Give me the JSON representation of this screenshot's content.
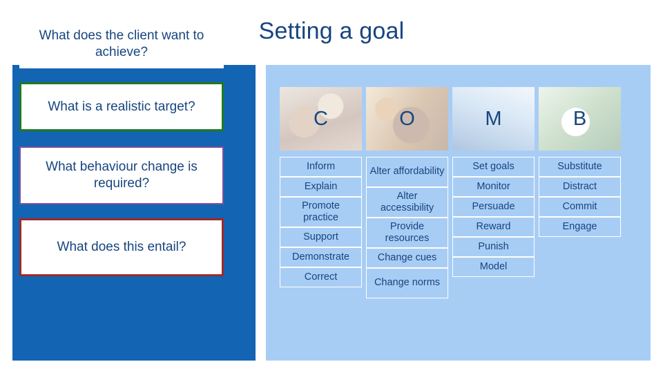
{
  "slide": {
    "title": "Setting a goal"
  },
  "left_panel": {
    "questions": [
      {
        "text": "What does the client want to achieve?",
        "border_color": "#ffffff"
      },
      {
        "text": "What is a realistic target?",
        "border_color": "#1f7a1f"
      },
      {
        "text": "What behaviour change is required?",
        "border_color": "#7e4f9e"
      },
      {
        "text": "What does this entail?",
        "border_color": "#9e2a2a"
      }
    ]
  },
  "com_b": {
    "columns": [
      {
        "letter": "C",
        "image_name": "capability-photo",
        "items": [
          {
            "label": "Inform",
            "size": "one"
          },
          {
            "label": "Explain",
            "size": "one"
          },
          {
            "label": "Promote practice",
            "size": "two"
          },
          {
            "label": "Support",
            "size": "one"
          },
          {
            "label": "Demonstrate",
            "size": "one"
          },
          {
            "label": "Correct",
            "size": "one"
          }
        ]
      },
      {
        "letter": "O",
        "image_name": "opportunity-photo",
        "items": [
          {
            "label": "Alter affordability",
            "size": "two"
          },
          {
            "label": "Alter accessibility",
            "size": "two"
          },
          {
            "label": "Provide resources",
            "size": "two"
          },
          {
            "label": "Change cues",
            "size": "one"
          },
          {
            "label": "Change norms",
            "size": "two"
          }
        ]
      },
      {
        "letter": "M",
        "image_name": "motivation-photo",
        "items": [
          {
            "label": "Set goals",
            "size": "one"
          },
          {
            "label": "Monitor",
            "size": "one"
          },
          {
            "label": "Persuade",
            "size": "one"
          },
          {
            "label": "Reward",
            "size": "one"
          },
          {
            "label": "Punish",
            "size": "one"
          },
          {
            "label": "Model",
            "size": "one"
          }
        ]
      },
      {
        "letter": "B",
        "image_name": "behaviour-photo",
        "items": [
          {
            "label": "Substitute",
            "size": "one"
          },
          {
            "label": "Distract",
            "size": "one"
          },
          {
            "label": "Commit",
            "size": "one"
          },
          {
            "label": "Engage",
            "size": "one"
          }
        ]
      }
    ]
  },
  "colors": {
    "title": "#17457e",
    "left_panel_bg": "#1464b4",
    "right_panel_bg": "#a8cdf5",
    "text": "#17457e"
  }
}
